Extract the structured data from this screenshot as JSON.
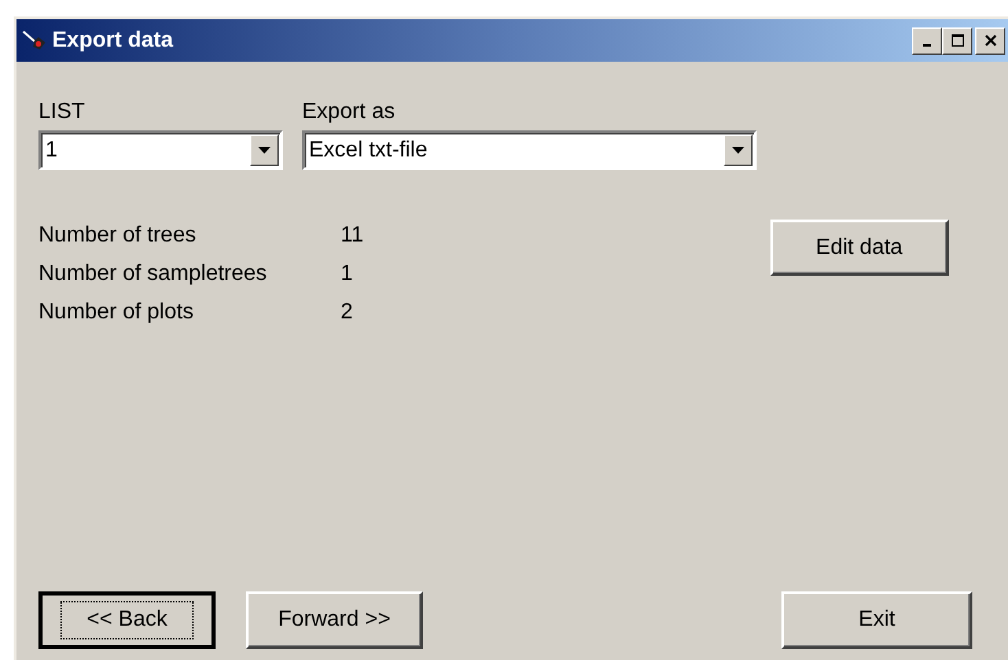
{
  "window": {
    "title": "Export data",
    "controls": [
      {
        "kind": "minimize"
      },
      {
        "kind": "maximize"
      },
      {
        "kind": "close"
      }
    ]
  },
  "list_field": {
    "label": "LIST",
    "value": "1"
  },
  "export_field": {
    "label": "Export as",
    "value": "Excel txt-file"
  },
  "stats": [
    {
      "label": "Number of trees",
      "value": "11"
    },
    {
      "label": "Number of sampletrees",
      "value": "1"
    },
    {
      "label": "Number of plots",
      "value": "2"
    }
  ],
  "edit_button": {
    "label": "Edit data"
  },
  "buttons": [
    {
      "label": "<< Back",
      "focused": true
    },
    {
      "label": "Forward >>",
      "focused": false
    },
    {
      "label": "Exit",
      "focused": false
    }
  ]
}
